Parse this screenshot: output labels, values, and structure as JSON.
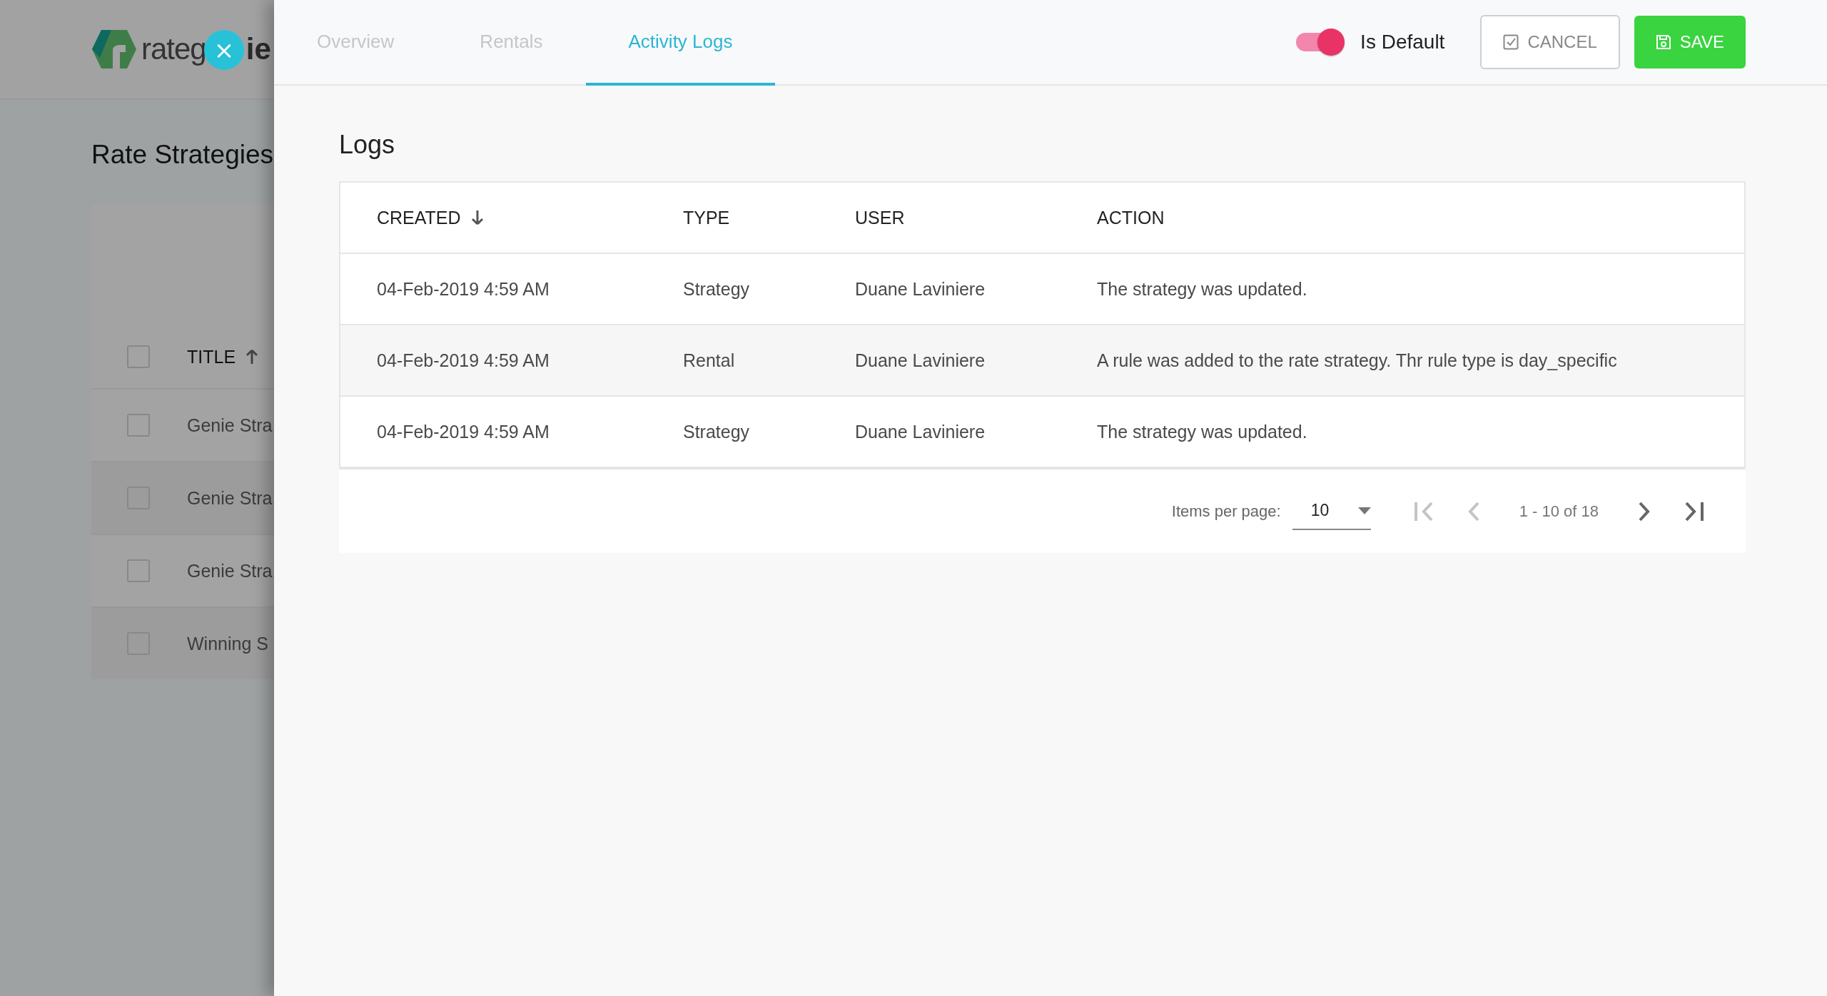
{
  "background_page": {
    "logo": {
      "text_before": "rateg",
      "text_after": "ie"
    },
    "title": "Rate Strategies",
    "table": {
      "columns": [
        {
          "label": "TITLE",
          "sorted": true,
          "ascending": true
        }
      ],
      "header_checkbox": {
        "checked": false
      },
      "rows": [
        {
          "title": "Genie Stra",
          "checked": false
        },
        {
          "title": "Genie Stra",
          "checked": false
        },
        {
          "title": "Genie Stra",
          "checked": false
        },
        {
          "title": "Winning S",
          "checked": false
        }
      ]
    }
  },
  "close_button": {
    "label": "×"
  },
  "panel": {
    "tabs": [
      {
        "label": "Overview",
        "selected": false
      },
      {
        "label": "Rentals",
        "selected": false
      },
      {
        "label": "Activity Logs",
        "selected": true
      }
    ],
    "default_toggle": {
      "label": "Is Default",
      "on": true
    },
    "buttons": [
      {
        "kind": "cancel",
        "label": "CANCEL"
      },
      {
        "kind": "save",
        "label": "SAVE"
      }
    ],
    "logs": {
      "title": "Logs",
      "columns": [
        {
          "label": "CREATED",
          "sorted": true,
          "ascending": false
        },
        {
          "label": "TYPE",
          "sorted": false
        },
        {
          "label": "USER",
          "sorted": false
        },
        {
          "label": "ACTION",
          "sorted": false
        }
      ],
      "rows": [
        [
          "04-Feb-2019 4:59 AM",
          "Strategy",
          "Duane Laviniere",
          "The strategy was updated."
        ],
        [
          "04-Feb-2019 4:59 AM",
          "Rental",
          "Duane Laviniere",
          "A rule was added to the rate strategy. Thr rule type is day_specific"
        ],
        [
          "04-Feb-2019 4:59 AM",
          "Strategy",
          "Duane Laviniere",
          "The strategy was updated."
        ]
      ],
      "pagination": {
        "items_per_page_label": "Items per page:",
        "page_size": "10",
        "range": "1 - 10 of 18",
        "first": {
          "disabled": true
        },
        "previous": {
          "disabled": true
        },
        "next": {
          "disabled": false
        },
        "last": {
          "disabled": false
        }
      }
    }
  }
}
